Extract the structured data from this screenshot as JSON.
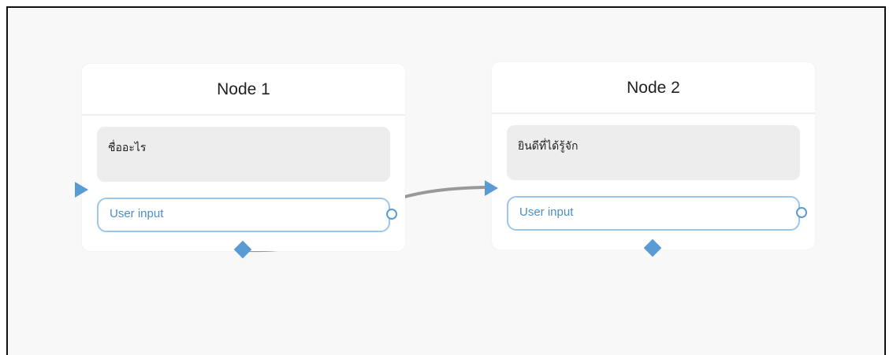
{
  "nodes": [
    {
      "title": "Node 1",
      "message": "ชื่ออะไร",
      "input_label": "User input"
    },
    {
      "title": "Node 2",
      "message": "ยินดีที่ได้รู้จัก",
      "input_label": "User input"
    }
  ],
  "colors": {
    "port": "#5a9bd5",
    "input_border": "#9cc7ea",
    "edge": "#999999"
  }
}
